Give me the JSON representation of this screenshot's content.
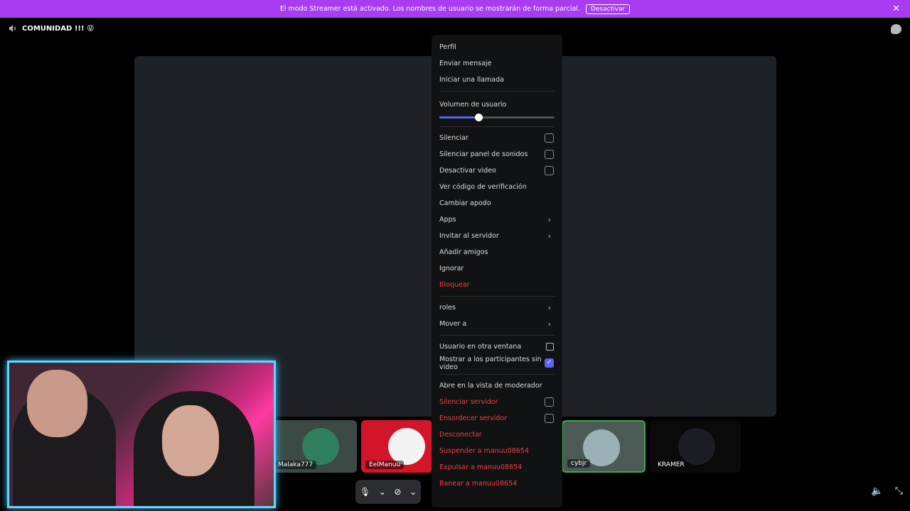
{
  "streamer_banner": {
    "message": "El modo Streamer está activado. Los nombres de usuario se mostrarán de forma parcial.",
    "button": "Desactivar",
    "close_icon": "close-icon"
  },
  "channel": {
    "name": "COMUNIDAD !!! 😝",
    "icon": "speaker-icon"
  },
  "participants": [
    {
      "name": "Malaka777"
    },
    {
      "name": "EelManuu"
    },
    {
      "name": "cybjr"
    },
    {
      "name": "KRAMER"
    }
  ],
  "context_menu": {
    "profile": "Perfil",
    "send_message": "Enviar mensaje",
    "start_call": "Iniciar una llamada",
    "user_volume_label": "Volumen de usuario",
    "user_volume_value": 0.34,
    "mute": "Silenciar",
    "mute_soundboard": "Silenciar panel de sonidos",
    "disable_video": "Desactivar video",
    "view_verification": "Ver código de verificación",
    "change_nickname": "Cambiar apodo",
    "apps": "Apps",
    "invite_server": "Invitar al servidor",
    "add_friend": "Añadir amigos",
    "ignore": "Ignorar",
    "block": "Bloquear",
    "roles": "roles",
    "move_to": "Mover a",
    "user_other_window": "Usuario en otra ventana",
    "show_no_video": "Mostrar a los participantes sin video",
    "open_mod_view": "Abre en la vista de moderador",
    "server_mute": "Silenciar servidor",
    "server_deafen": "Ensordecer servidor",
    "disconnect": "Desconectar",
    "timeout": "Suspender a manuu08654",
    "kick": "Expulsar a manuu08654",
    "ban": "Banear a manuu08654"
  },
  "colors": {
    "banner": "#a73cf0",
    "accent": "#5865f2",
    "danger": "#f23f43"
  }
}
